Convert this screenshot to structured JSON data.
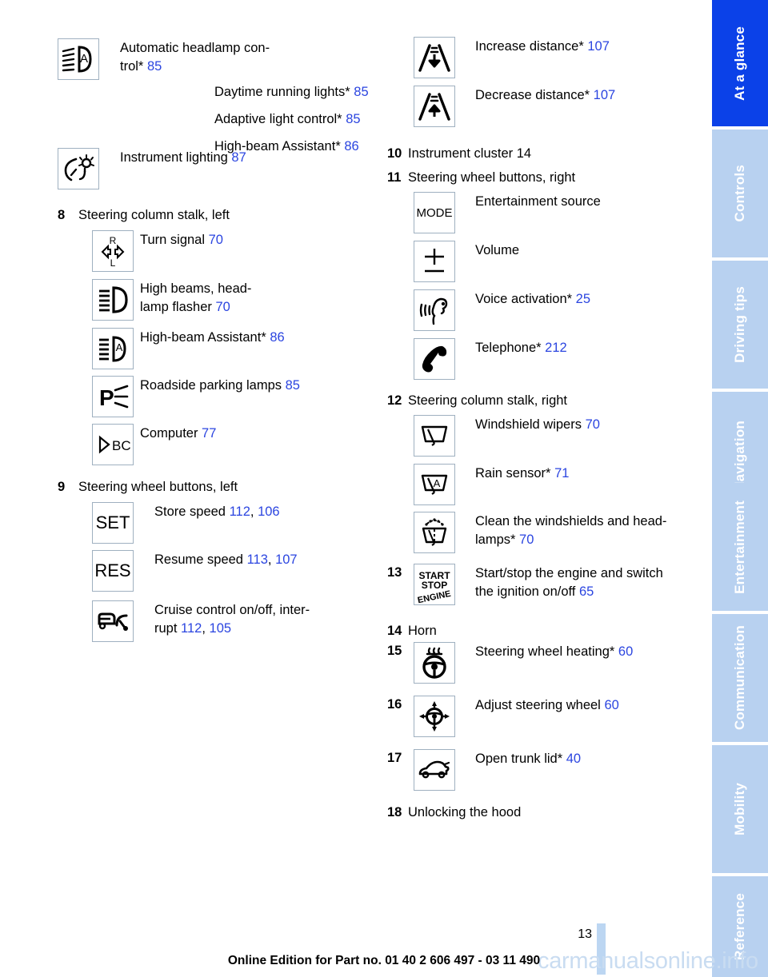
{
  "document": {
    "page_number": "13",
    "edition_line": "Online Edition for Part no. 01 40 2 606 497 - 03 11 490",
    "watermark": "carmanualsonline.info",
    "link_color": "#2b45e0",
    "active_tab_color": "#0b41e8",
    "tab_color": "#b8d1f0"
  },
  "sidebar": {
    "tabs": [
      {
        "label": "At a glance",
        "active": true
      },
      {
        "label": "Controls",
        "active": false
      },
      {
        "label": "Driving tips",
        "active": false
      },
      {
        "label": "Navigation",
        "active": false
      },
      {
        "label": "Entertainment",
        "active": false
      },
      {
        "label": "Communication",
        "active": false
      },
      {
        "label": "Mobility",
        "active": false
      },
      {
        "label": "Reference",
        "active": false
      }
    ]
  },
  "left_column": {
    "lighting_group": {
      "line1_text": "Automatic headlamp con-",
      "line1_text2": "trol*",
      "line1_page": "85",
      "line2_text": "Daytime running lights*",
      "line2_page": "85",
      "line3_text": "Adaptive light control*",
      "line3_page": "85",
      "line4_text": "High-beam Assistant*",
      "line4_page": "86",
      "line5_text": "Instrument lighting",
      "line5_page": "87",
      "icon1_name": "automatic-headlamp-control-icon",
      "icon2_name": "instrument-lighting-icon"
    },
    "item8": {
      "number": "8",
      "title": "Steering column stalk, left",
      "entries": [
        {
          "icon": "turn-signal-icon",
          "label": "Turn signal",
          "page": "70"
        },
        {
          "icon": "high-beams-headlamp-flasher-icon",
          "label": "High beams, head-",
          "label2": "lamp flasher",
          "page": "70"
        },
        {
          "icon": "high-beam-assistant-icon",
          "label": "High-beam Assistant*",
          "page": "86"
        },
        {
          "icon": "roadside-parking-lamps-icon",
          "label": "Roadside parking lamps",
          "page": "85"
        },
        {
          "icon": "computer-bc-icon",
          "label": "Computer",
          "page": "77"
        }
      ]
    },
    "item9": {
      "number": "9",
      "title": "Steering wheel buttons, left",
      "entries": [
        {
          "icon": "set-button-icon",
          "glyph": "SET",
          "label": "Store speed",
          "page": "112",
          "page2": "106"
        },
        {
          "icon": "res-button-icon",
          "glyph": "RES",
          "label": "Resume speed",
          "page": "113",
          "page2": "107"
        },
        {
          "icon": "cruise-control-icon",
          "label": "Cruise control on/off, inter-",
          "label2": "rupt",
          "page": "112",
          "page2": "105"
        }
      ]
    }
  },
  "right_column": {
    "distance_group": [
      {
        "icon": "increase-distance-icon",
        "label": "Increase distance*",
        "page": "107"
      },
      {
        "icon": "decrease-distance-icon",
        "label": "Decrease distance*",
        "page": "107"
      }
    ],
    "item10": {
      "number": "10",
      "title": "Instrument cluster",
      "page": "14"
    },
    "item11": {
      "number": "11",
      "title": "Steering wheel buttons, right",
      "entries": [
        {
          "icon": "mode-button-icon",
          "glyph": "MODE",
          "label": "Entertainment source",
          "page": ""
        },
        {
          "icon": "volume-button-icon",
          "label": "Volume",
          "page": ""
        },
        {
          "icon": "voice-activation-icon",
          "label": "Voice activation*",
          "page": "25"
        },
        {
          "icon": "telephone-icon",
          "label": "Telephone*",
          "page": "212"
        }
      ]
    },
    "item12": {
      "number": "12",
      "title": "Steering column stalk, right",
      "entries": [
        {
          "icon": "windshield-wipers-icon",
          "label": "Windshield wipers",
          "page": "70"
        },
        {
          "icon": "rain-sensor-icon",
          "label": "Rain sensor*",
          "page": "71"
        },
        {
          "icon": "clean-windshields-headlamps-icon",
          "label": "Clean the windshields and head-",
          "label2": "lamps*",
          "page": "70"
        }
      ]
    },
    "item13": {
      "number": "13",
      "icon": "start-stop-engine-icon",
      "glyph_line1": "START",
      "glyph_line2": "STOP",
      "glyph_line3": "ENGINE",
      "label": "Start/stop the engine and switch",
      "label2": "the ignition on/off",
      "page": "65"
    },
    "item14": {
      "number": "14",
      "title": "Horn"
    },
    "item15": {
      "number": "15",
      "icon": "steering-wheel-heating-icon",
      "label": "Steering wheel heating*",
      "page": "60"
    },
    "item16": {
      "number": "16",
      "icon": "adjust-steering-wheel-icon",
      "label": "Adjust steering wheel",
      "page": "60"
    },
    "item17": {
      "number": "17",
      "icon": "open-trunk-lid-icon",
      "label": "Open trunk lid*",
      "page": "40"
    },
    "item18": {
      "number": "18",
      "title": "Unlocking the hood"
    }
  }
}
